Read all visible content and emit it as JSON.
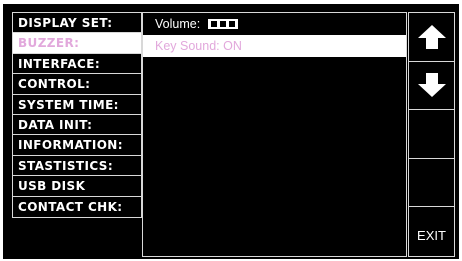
{
  "menu": {
    "items": [
      {
        "label": "DISPLAY SET:"
      },
      {
        "label": "BUZZER:",
        "selected": true
      },
      {
        "label": "INTERFACE:"
      },
      {
        "label": "CONTROL:"
      },
      {
        "label": "SYSTEM TIME:"
      },
      {
        "label": "DATA INIT:"
      },
      {
        "label": "INFORMATION:"
      },
      {
        "label": "STASTISTICS:"
      },
      {
        "label": "USB DISK"
      },
      {
        "label": "CONTACT CHK:"
      }
    ]
  },
  "panel": {
    "volume_label": "Volume:",
    "volume_level": 3,
    "key_sound": "Key Sound: ON"
  },
  "side": {
    "up_icon": "arrow-up-icon",
    "down_icon": "arrow-down-icon",
    "exit_label": "EXIT"
  },
  "colors": {
    "background": "#000000",
    "selected_text": "#e2a8dc",
    "highlight": "#ffffff"
  }
}
